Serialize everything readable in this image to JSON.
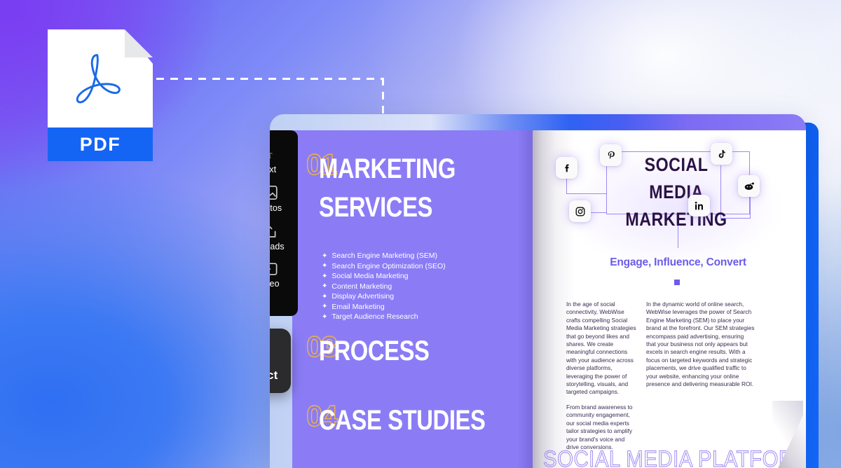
{
  "background": {
    "gradient_purple": "#7b52f0",
    "gradient_blue": "#2f6ff2",
    "gradient_light": "#f2f3fb",
    "side_panel_blue": "#0e63f7"
  },
  "source_file": {
    "type_label": "PDF",
    "icon": "pdf-file-icon",
    "glyph": "acrobat-swirl",
    "band_color": "#1565f5"
  },
  "connector": {
    "style": "dashed",
    "color": "#ffffff"
  },
  "toolbar": {
    "background": "#0a0a0a",
    "items": [
      {
        "label": "Text",
        "icon": "text-tool-icon"
      },
      {
        "label": "Photos",
        "icon": "photos-tool-icon"
      },
      {
        "label": "Uploads",
        "icon": "uploads-tool-icon"
      },
      {
        "label": "Video",
        "icon": "video-tool-icon"
      }
    ]
  },
  "interact_button": {
    "label": "Interact",
    "icon": "tap-hand-icon",
    "background": "#2b2b2d"
  },
  "document": {
    "left_page": {
      "background": "#8b7cf6",
      "number_color": "#f0b43c",
      "sections": [
        {
          "number": "01",
          "title_line1": "MARKETING",
          "title_line2": "SERVICES"
        },
        {
          "number": "03",
          "title_line1": "PROCESS",
          "title_line2": ""
        },
        {
          "number": "04",
          "title_line1": "CASE STUDIES",
          "title_line2": ""
        }
      ],
      "services": [
        "Search Engine Marketing (SEM)",
        "Search Engine Optimization (SEO)",
        "Social Media Marketing",
        "Content Marketing",
        "Display Advertising",
        "Email Marketing",
        "Target Audience Research"
      ],
      "bullet_glyph": "✦"
    },
    "right_page": {
      "background": "#ffffff",
      "title_line1": "SOCIAL MEDIA",
      "title_line2": "MARKETING",
      "title_color": "#2a1245",
      "tagline": "Engage, Influence, Convert",
      "tagline_color": "#6c5ce7",
      "connector_color": "#9d8bf0",
      "social_icons": [
        {
          "name": "facebook",
          "glyph": "f"
        },
        {
          "name": "pinterest",
          "glyph": "P"
        },
        {
          "name": "instagram",
          "glyph": "camera"
        },
        {
          "name": "tiktok",
          "glyph": "note"
        },
        {
          "name": "linkedin",
          "glyph": "in"
        },
        {
          "name": "reddit",
          "glyph": "alien"
        }
      ],
      "column_left": [
        "In the age of social connectivity, WebWise crafts compelling Social Media Marketing strategies that go beyond likes and shares. We create meaningful connections with your audience across diverse platforms, leveraging the power of storytelling, visuals, and targeted campaigns.",
        "From brand awareness to community engagement, our social media experts tailor strategies to amplify your brand's voice and drive conversions."
      ],
      "column_right": [
        "In the dynamic world of online search, WebWise leverages the power of Search Engine Marketing (SEM) to place your brand at the forefront. Our SEM strategies encompass paid advertising, ensuring that your business not only appears but excels in search engine results. With a focus on targeted keywords and strategic placements, we drive qualified traffic to your website, enhancing your online presence and delivering measurable ROI."
      ],
      "footer_title": "SOCIAL MEDIA PLATFORMS & PRI"
    }
  }
}
